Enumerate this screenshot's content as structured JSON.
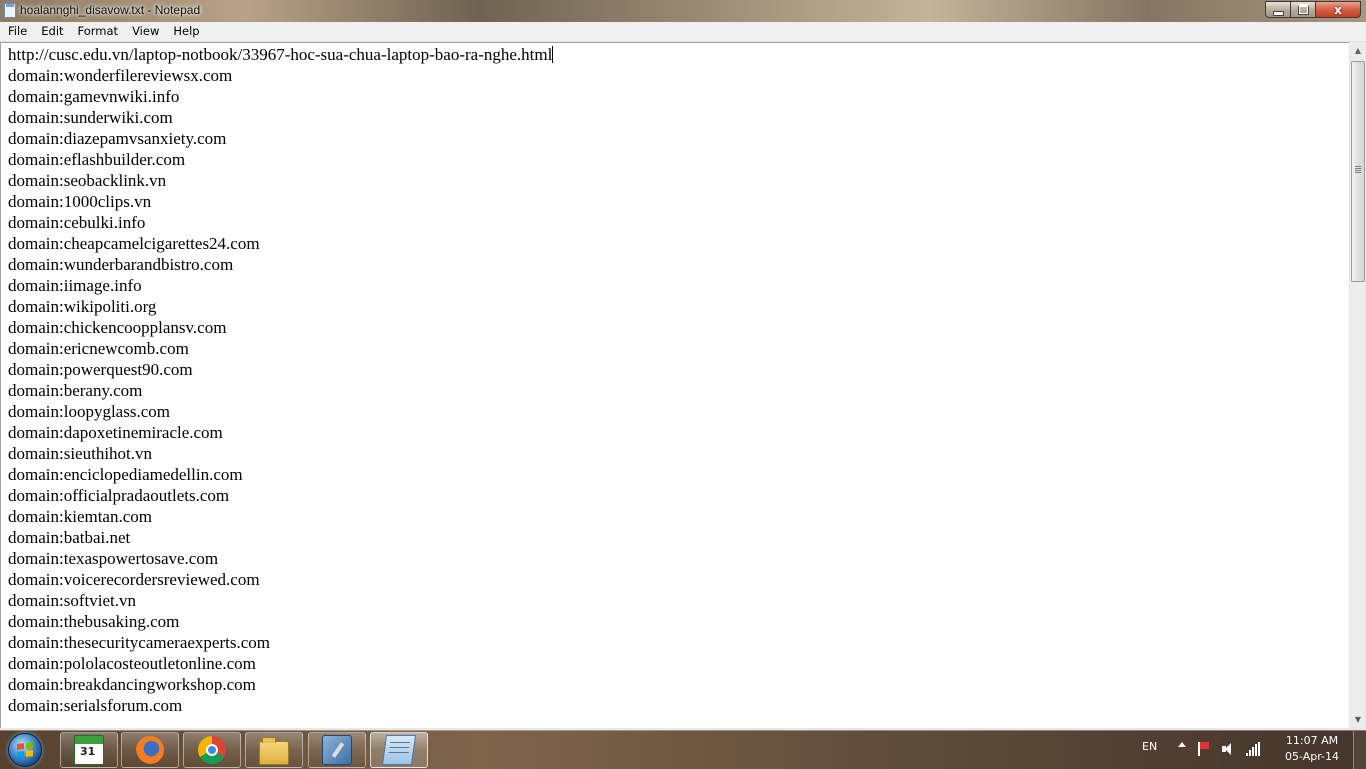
{
  "window": {
    "title": "hoalannghi_disavow.txt - Notepad",
    "close_glyph": "x"
  },
  "menu": [
    "File",
    "Edit",
    "Format",
    "View",
    "Help"
  ],
  "document": {
    "lines": [
      "http://cusc.edu.vn/laptop-notbook/33967-hoc-sua-chua-laptop-bao-ra-nghe.html",
      "domain:wonderfilereviewsx.com",
      "domain:gamevnwiki.info",
      "domain:sunderwiki.com",
      "domain:diazepamvsanxiety.com",
      "domain:eflashbuilder.com",
      "domain:seobacklink.vn",
      "domain:1000clips.vn",
      "domain:cebulki.info",
      "domain:cheapcamelcigarettes24.com",
      "domain:wunderbarandbistro.com",
      "domain:iimage.info",
      "domain:wikipoliti.org",
      "domain:chickencoopplansv.com",
      "domain:ericnewcomb.com",
      "domain:powerquest90.com",
      "domain:berany.com",
      "domain:loopyglass.com",
      "domain:dapoxetinemiracle.com",
      "domain:sieuthihot.vn",
      "domain:enciclopediamedellin.com",
      "domain:officialpradaoutlets.com",
      "domain:kiemtan.com",
      "domain:batbai.net",
      "domain:texaspowertosave.com",
      "domain:voicerecordersreviewed.com",
      "domain:softviet.vn",
      "domain:thebusaking.com",
      "domain:thesecuritycameraexperts.com",
      "domain:pololacosteoutletonline.com",
      "domain:breakdancingworkshop.com",
      "domain:serialsforum.com"
    ]
  },
  "scrollbar": {
    "up_glyph": "▲",
    "down_glyph": "▼"
  },
  "taskbar": {
    "apps": [
      {
        "name": "calendar-app",
        "icon": "calendar-icon"
      },
      {
        "name": "firefox",
        "icon": "firefox-icon"
      },
      {
        "name": "chrome",
        "icon": "chrome-icon"
      },
      {
        "name": "windows-explorer",
        "icon": "folder-icon"
      },
      {
        "name": "tool-app",
        "icon": "tool-icon"
      },
      {
        "name": "notepad",
        "icon": "notepad-icon",
        "active": true
      }
    ],
    "tray": {
      "language": "EN",
      "time": "11:07 AM",
      "date": "05-Apr-14"
    }
  }
}
